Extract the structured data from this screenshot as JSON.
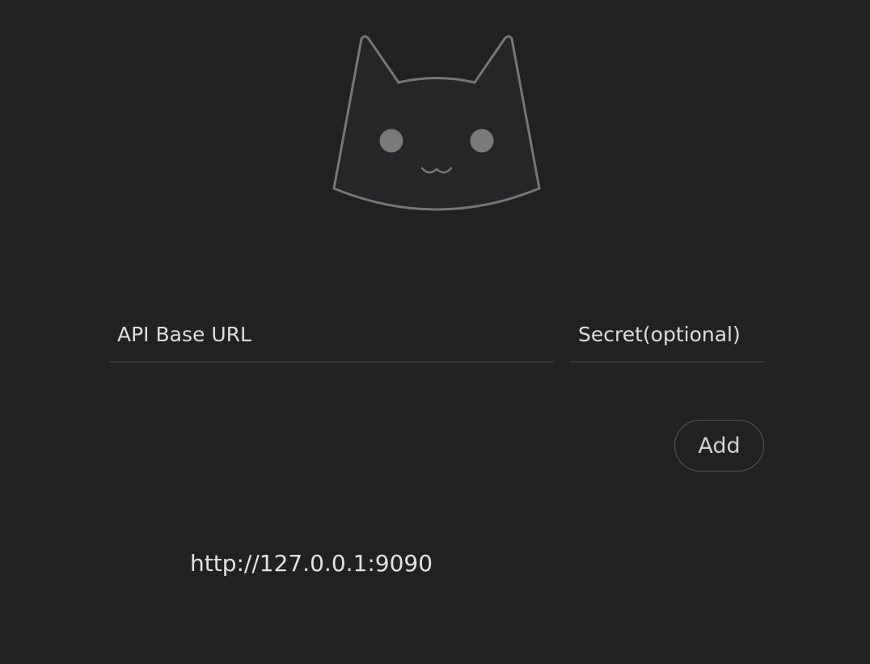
{
  "logo": {
    "icon": "cat-face-icon",
    "stroke_color": "#777777",
    "fill_color": "#262628",
    "eye_color": "#7a7a7a"
  },
  "form": {
    "url_placeholder": "API Base URL",
    "url_value": "",
    "secret_placeholder": "Secret(optional)",
    "secret_value": "",
    "add_label": "Add"
  },
  "backends": [
    {
      "url": "http://127.0.0.1:9090"
    }
  ]
}
